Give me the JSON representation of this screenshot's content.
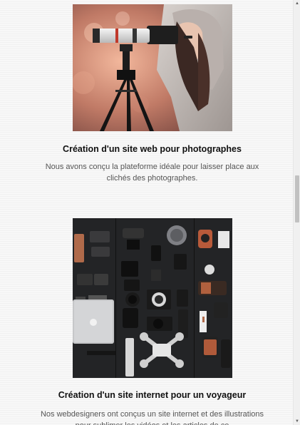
{
  "cards": [
    {
      "image_alt": "woman-with-camera-on-tripod",
      "title": "Création d'un site web pour photographes",
      "text": "Nous avons conçu la plateforme idéale pour laisser place aux clichés des photographes."
    },
    {
      "image_alt": "photography-gear-flatlay",
      "title": "Création d'un site internet pour un voyageur",
      "text": "Nos webdesigners ont conçus un site internet et des illustrations pour sublimer les vidéos et les articles de ce"
    }
  ],
  "scrollbar": {
    "up_icon": "triangle-up-icon",
    "down_icon": "triangle-down-icon",
    "position_fraction": 0.44
  },
  "colors": {
    "background": "#f6f6f6",
    "title": "#111111",
    "text": "#555555",
    "scroll_thumb": "#c1c1c1"
  }
}
